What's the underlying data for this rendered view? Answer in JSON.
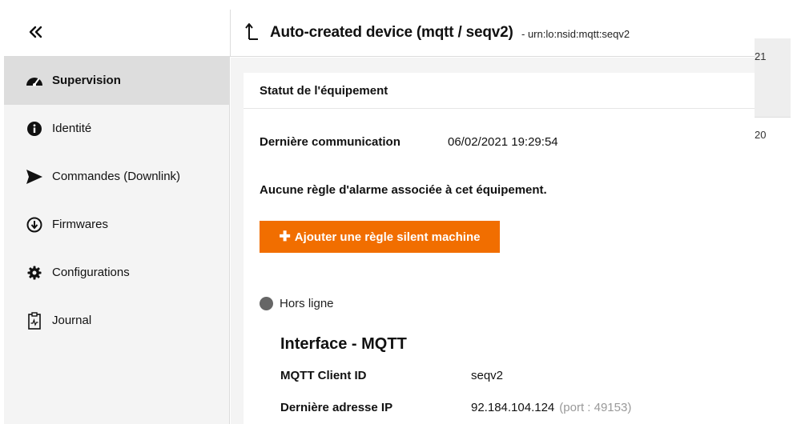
{
  "background": {
    "value_top": "21",
    "value_bottom": "20"
  },
  "header": {
    "collapse_icon": "double-chevron-left-icon",
    "back_icon": "back-arrow-icon",
    "title": "Auto-created device (mqtt / seqv2)",
    "urn": "- urn:lo:nsid:mqtt:seqv2"
  },
  "sidebar": {
    "items": [
      {
        "label": "Supervision",
        "icon": "gauge-icon",
        "active": true
      },
      {
        "label": "Identité",
        "icon": "info-icon",
        "active": false
      },
      {
        "label": "Commandes (Downlink)",
        "icon": "send-icon",
        "active": false
      },
      {
        "label": "Firmwares",
        "icon": "download-icon",
        "active": false
      },
      {
        "label": "Configurations",
        "icon": "gear-icon",
        "active": false
      },
      {
        "label": "Journal",
        "icon": "clipboard-icon",
        "active": false
      }
    ]
  },
  "main": {
    "card_title": "Statut de l'équipement",
    "last_comm_label": "Dernière communication",
    "last_comm_value": "06/02/2021 19:29:54",
    "alarm_note": "Aucune règle d'alarme associée à cet équipement.",
    "add_rule_button": "Ajouter une règle silent machine",
    "status": "Hors ligne",
    "status_color": "#666666",
    "interface_title": "Interface - MQTT",
    "client_id_label": "MQTT Client ID",
    "client_id_value": "seqv2",
    "ip_label": "Dernière adresse IP",
    "ip_value": "92.184.104.124",
    "port_text": "(port : 49153)"
  },
  "colors": {
    "accent": "#f16e00",
    "sidebar_bg": "#f4f4f4",
    "sidebar_active": "#dddddd"
  }
}
